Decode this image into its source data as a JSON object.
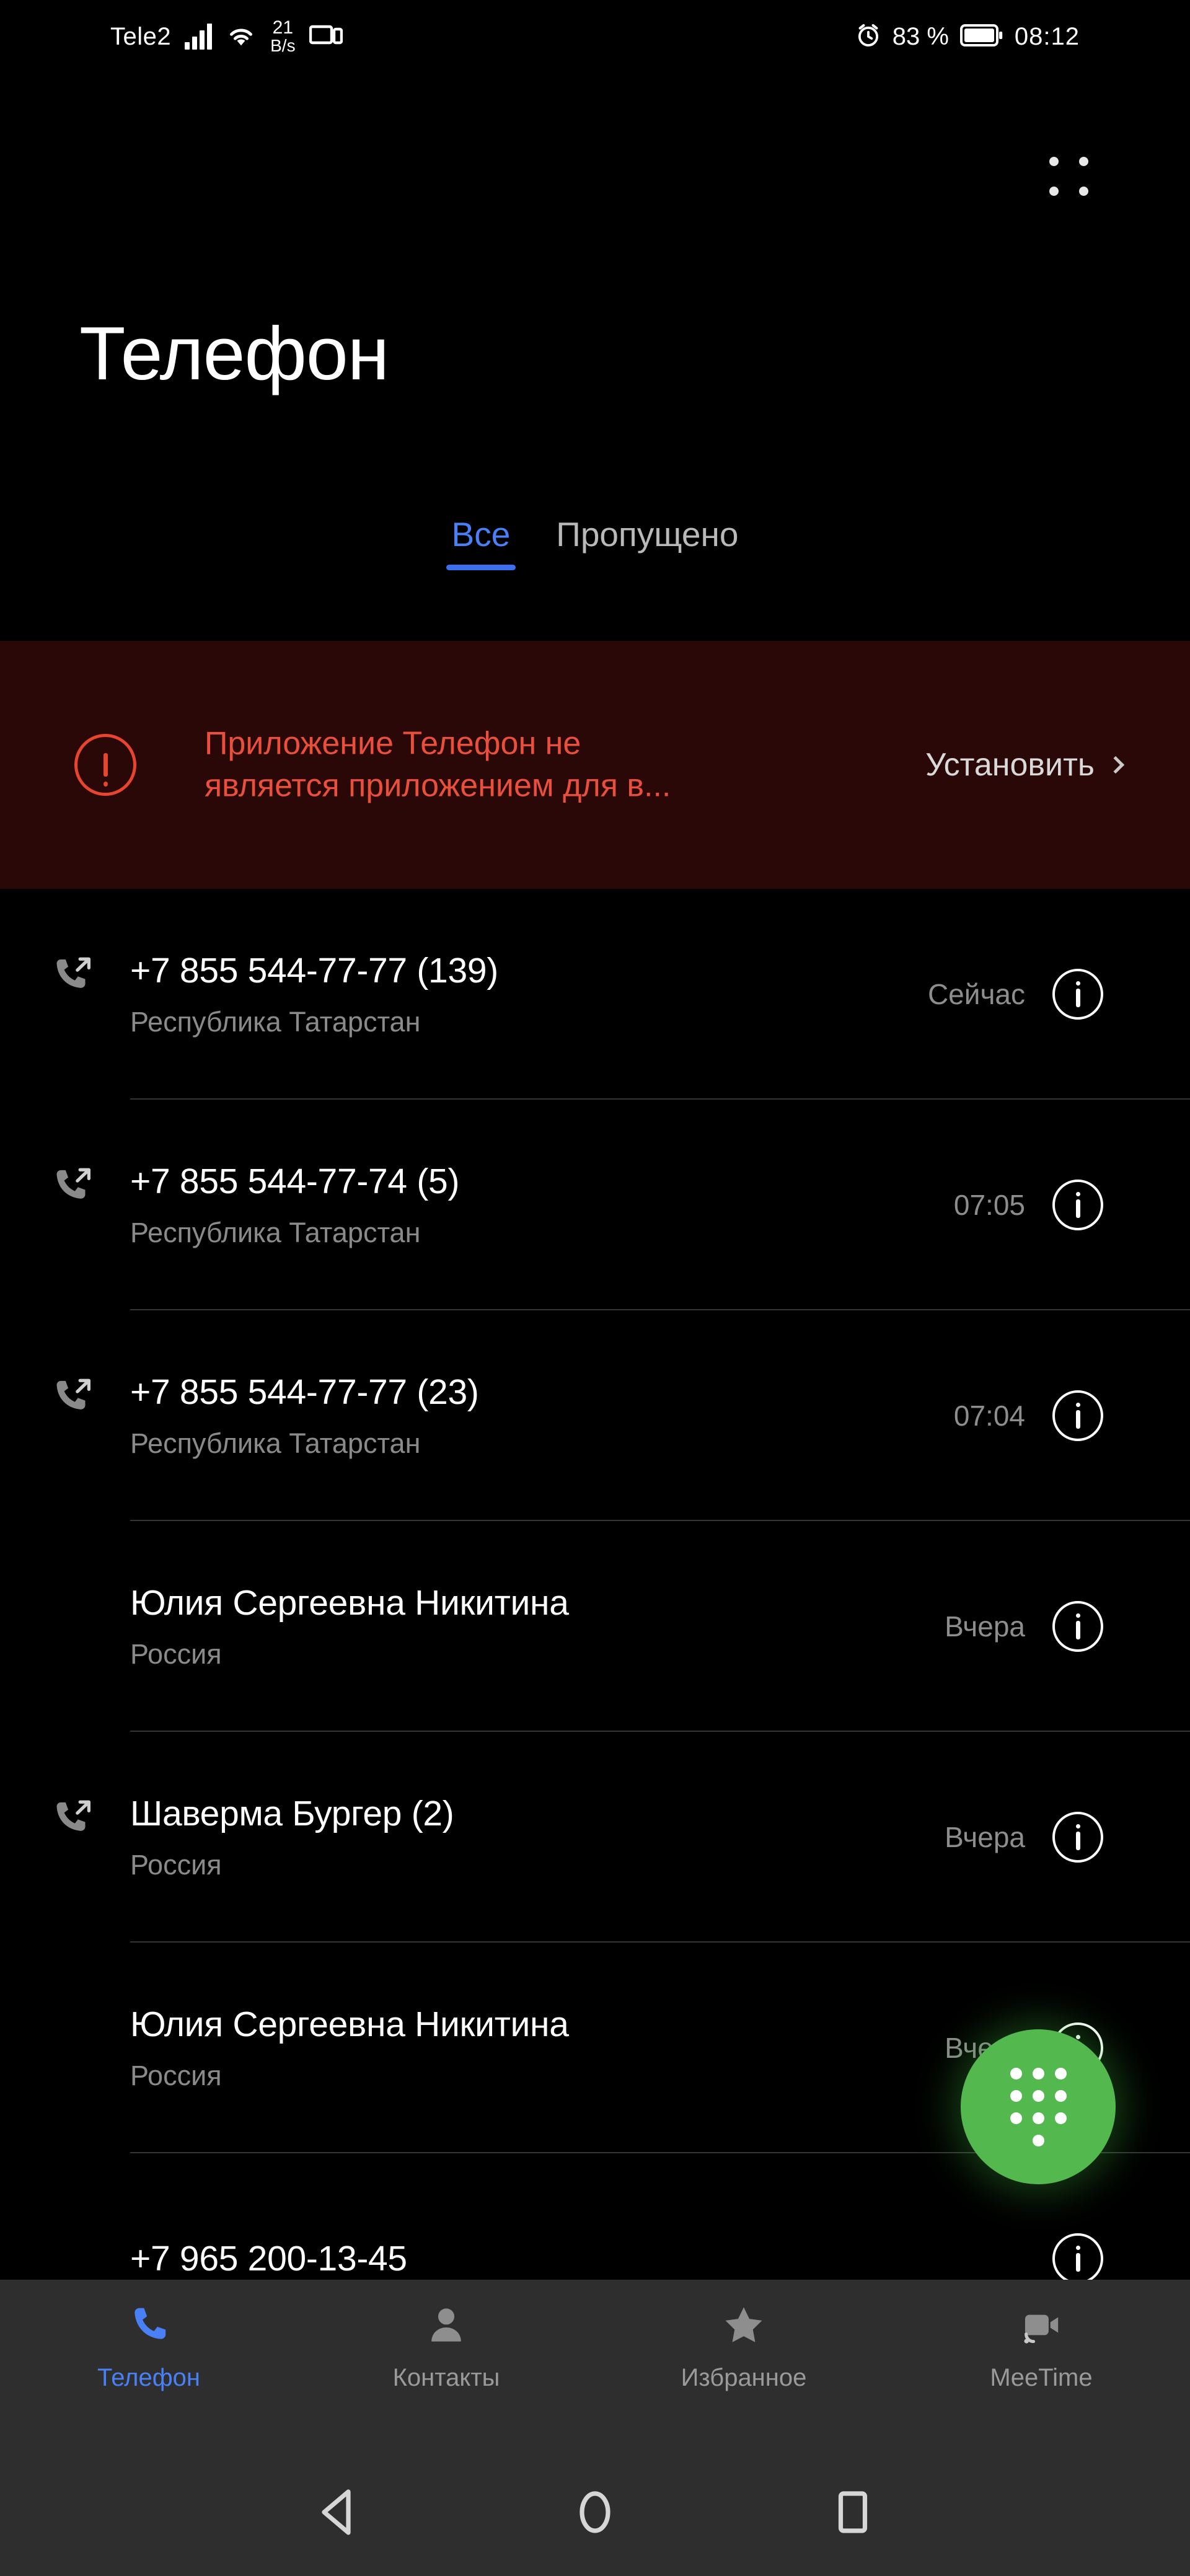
{
  "status_bar": {
    "carrier": "Tele2",
    "network_speed_value": "21",
    "network_speed_unit": "B/s",
    "battery_percent": "83 %",
    "clock": "08:12"
  },
  "header": {
    "title": "Телефон",
    "menu_icon": "grid-dots-icon"
  },
  "tabs": [
    {
      "label": "Все",
      "active": true
    },
    {
      "label": "Пропущено",
      "active": false
    }
  ],
  "banner": {
    "icon": "warning-circle-icon",
    "message": "Приложение Телефон не является приложением для в...",
    "action_label": "Установить",
    "chevron": "chevron-right-icon",
    "background_color": "#2b0808",
    "text_color": "#e8503c"
  },
  "calls": [
    {
      "name": "+7 855 544-77-77 (139)",
      "location": "Республика Татарстан",
      "time": "Сейчас",
      "direction_icon": "outgoing-call-icon",
      "has_direction_icon": true
    },
    {
      "name": "+7 855 544-77-74 (5)",
      "location": "Республика Татарстан",
      "time": "07:05",
      "direction_icon": "outgoing-call-icon",
      "has_direction_icon": true
    },
    {
      "name": "+7 855 544-77-77 (23)",
      "location": "Республика Татарстан",
      "time": "07:04",
      "direction_icon": "outgoing-call-icon",
      "has_direction_icon": true
    },
    {
      "name": "Юлия Сергеевна Никитина",
      "location": "Россия",
      "time": "Вчера",
      "direction_icon": "",
      "has_direction_icon": false
    },
    {
      "name": "Шаверма Бургер (2)",
      "location": "Россия",
      "time": "Вчера",
      "direction_icon": "outgoing-call-icon",
      "has_direction_icon": true
    },
    {
      "name": "Юлия Сергеевна Никитина",
      "location": "Россия",
      "time": "Вчера",
      "direction_icon": "",
      "has_direction_icon": false
    },
    {
      "name": "+7 965 200-13-45",
      "location": "",
      "time": "",
      "direction_icon": "",
      "has_direction_icon": false
    }
  ],
  "fab": {
    "icon": "dialpad-icon",
    "color": "#53b94f"
  },
  "bottom_nav": [
    {
      "label": "Телефон",
      "icon": "phone-icon",
      "active": true
    },
    {
      "label": "Контакты",
      "icon": "person-icon",
      "active": false
    },
    {
      "label": "Избранное",
      "icon": "star-icon",
      "active": false
    },
    {
      "label": "MeeTime",
      "icon": "video-call-icon",
      "active": false
    }
  ],
  "system_nav": [
    {
      "icon": "back-triangle-icon"
    },
    {
      "icon": "home-circle-icon"
    },
    {
      "icon": "recents-square-icon"
    }
  ],
  "colors": {
    "accent_blue": "#4a80f5",
    "fab_green": "#53b94f",
    "warning_red": "#e8452f",
    "background": "#000000",
    "nav_background": "#2e2e2e"
  }
}
